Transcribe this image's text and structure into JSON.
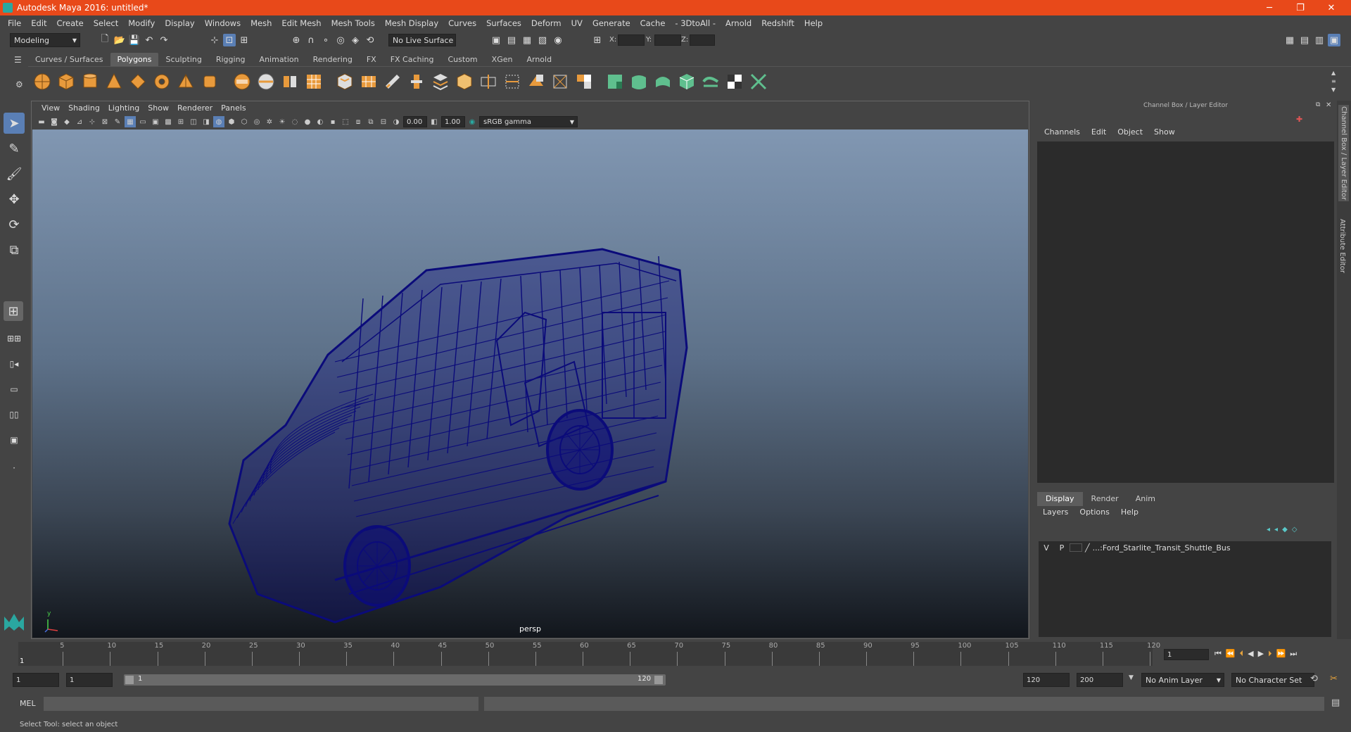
{
  "window": {
    "title": "Autodesk Maya 2016: untitled*",
    "minimize": "─",
    "maximize": "❐",
    "close": "✕"
  },
  "menubar": [
    "File",
    "Edit",
    "Create",
    "Select",
    "Modify",
    "Display",
    "Windows",
    "Mesh",
    "Edit Mesh",
    "Mesh Tools",
    "Mesh Display",
    "Curves",
    "Surfaces",
    "Deform",
    "UV",
    "Generate",
    "Cache",
    "- 3DtoAll -",
    "Arnold",
    "Redshift",
    "Help"
  ],
  "statusline": {
    "mode": "Modeling",
    "live_surface": "No Live Surface",
    "x_label": "X:",
    "y_label": "Y:",
    "z_label": "Z:"
  },
  "shelf_tabs": [
    "Curves / Surfaces",
    "Polygons",
    "Sculpting",
    "Rigging",
    "Animation",
    "Rendering",
    "FX",
    "FX Caching",
    "Custom",
    "XGen",
    "Arnold"
  ],
  "shelf_active": "Polygons",
  "viewport": {
    "menu": [
      "View",
      "Shading",
      "Lighting",
      "Show",
      "Renderer",
      "Panels"
    ],
    "exposure": "0.00",
    "gamma": "1.00",
    "color_space": "sRGB gamma",
    "camera_label": "persp",
    "axis_y": "y",
    "wire_color": "#0b0b7a"
  },
  "channel_box": {
    "title": "Channel Box / Layer Editor",
    "menu": [
      "Channels",
      "Edit",
      "Object",
      "Show"
    ],
    "layer_tabs": [
      "Display",
      "Render",
      "Anim"
    ],
    "layer_tab_active": "Display",
    "layer_menu": [
      "Layers",
      "Options",
      "Help"
    ],
    "layer": {
      "v": "V",
      "p": "P",
      "name": "...:Ford_Starlite_Transit_Shuttle_Bus"
    }
  },
  "side_tabs": [
    "Channel Box / Layer Editor",
    "Attribute Editor"
  ],
  "timeline": {
    "ticks": [
      "5",
      "10",
      "15",
      "20",
      "25",
      "30",
      "35",
      "40",
      "45",
      "50",
      "55",
      "60",
      "65",
      "70",
      "75",
      "80",
      "85",
      "90",
      "95",
      "100",
      "105",
      "110",
      "115",
      "120"
    ],
    "first": "1",
    "current_frame": "1"
  },
  "range": {
    "start": "1",
    "playback_start": "1",
    "slider_start": "1",
    "slider_end": "120",
    "playback_end": "120",
    "end": "200",
    "anim_layer": "No Anim Layer",
    "character_set": "No Character Set"
  },
  "command": {
    "label": "MEL"
  },
  "help_line": "Select Tool: select an object",
  "accent": "#5a7fb5",
  "titlebar_color": "#e8491a"
}
